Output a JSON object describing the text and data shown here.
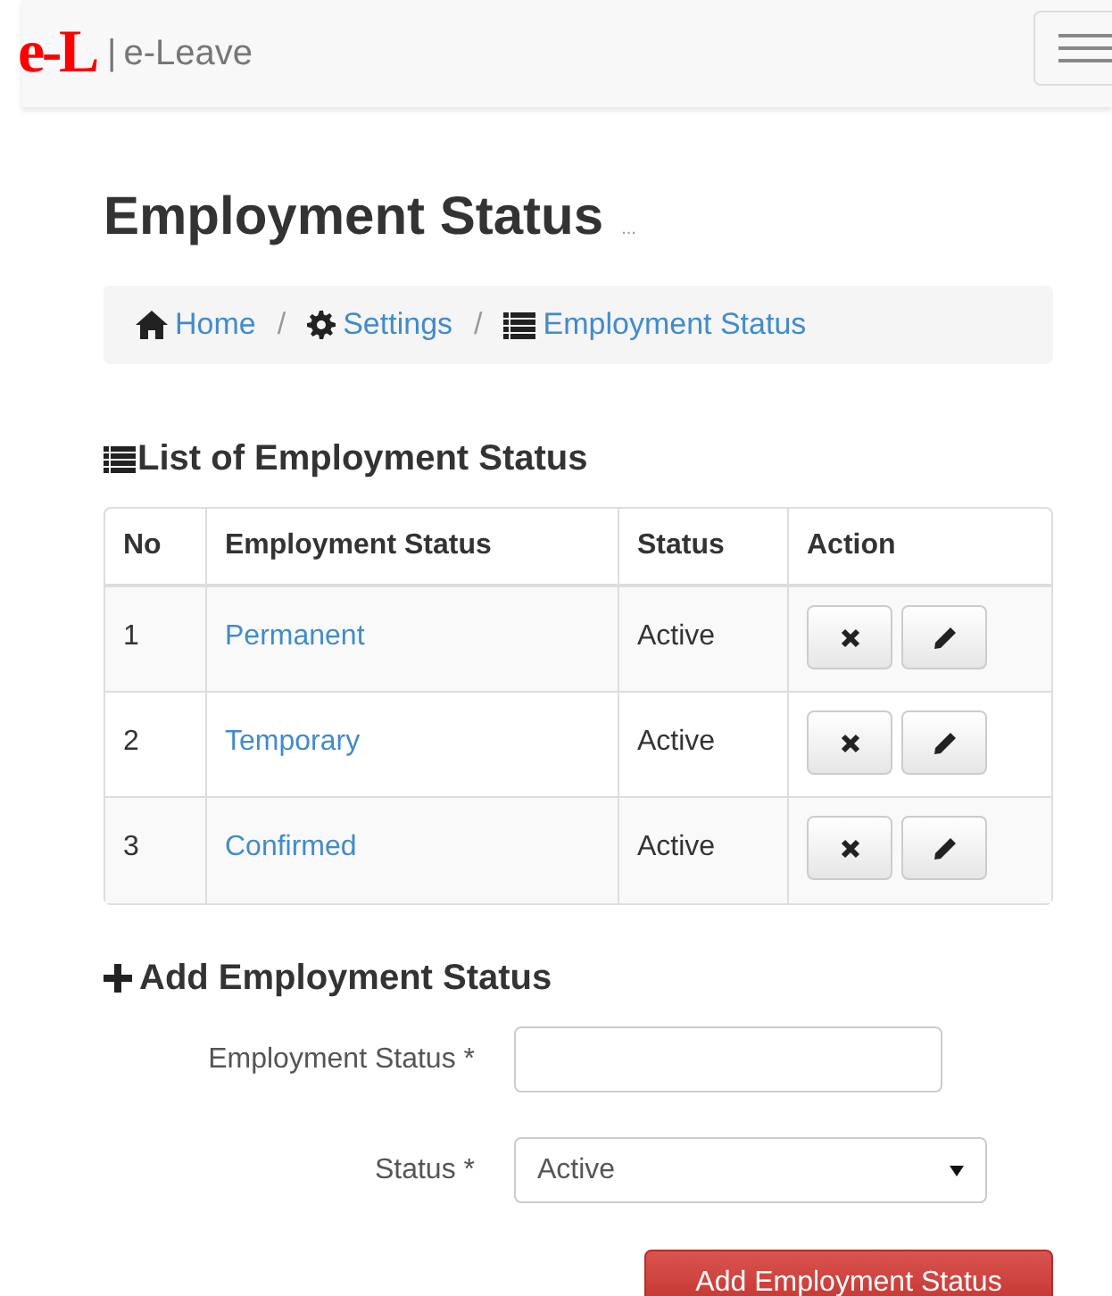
{
  "navbar": {
    "logo": "e-L",
    "separator": "|",
    "app_name": "e-Leave"
  },
  "page_title": "Employment Status",
  "page_subtitle": "...",
  "breadcrumb": [
    {
      "kind": "home",
      "label": "Home"
    },
    {
      "kind": "settings",
      "label": "Settings"
    },
    {
      "kind": "list",
      "label": "Employment Status"
    }
  ],
  "breadcrumb_separator": "/",
  "list_heading": "List of Employment Status",
  "table": {
    "columns": [
      "No",
      "Employment Status",
      "Status",
      "Action"
    ],
    "rows": [
      {
        "no": "1",
        "name": "Permanent",
        "status": "Active"
      },
      {
        "no": "2",
        "name": "Temporary",
        "status": "Active"
      },
      {
        "no": "3",
        "name": "Confirmed",
        "status": "Active"
      }
    ]
  },
  "add_heading": "Add Employment Status",
  "form": [
    {
      "kind": "input",
      "label": "Employment Status *"
    },
    {
      "kind": "select",
      "label": "Status *",
      "value": "Active"
    }
  ],
  "submit_button": "Add Employment Status"
}
